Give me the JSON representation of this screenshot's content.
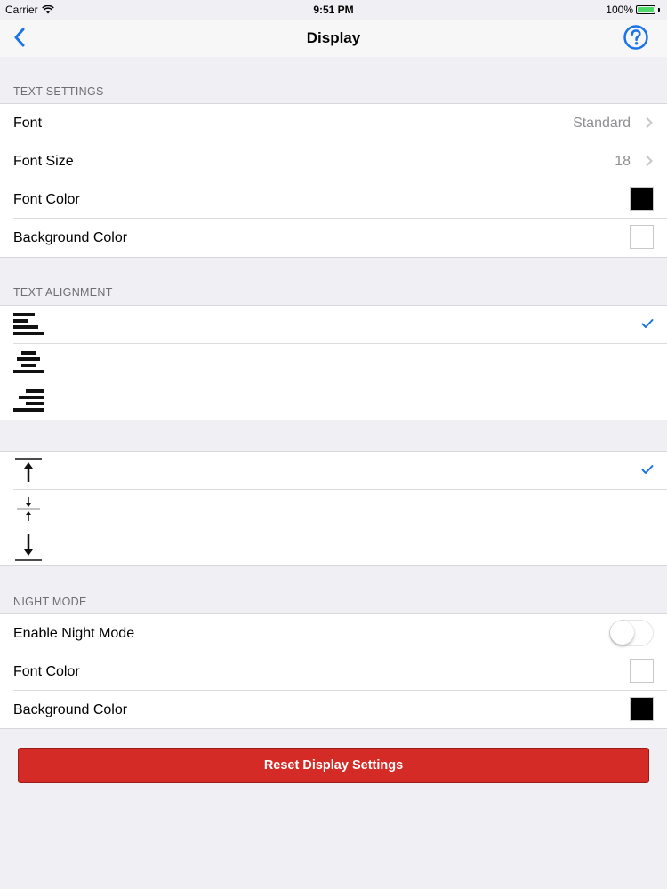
{
  "status_bar": {
    "carrier": "Carrier",
    "time": "9:51 PM",
    "battery": "100%",
    "battery_level": 1.0,
    "battery_color": "#4cd964"
  },
  "nav": {
    "title": "Display",
    "back_icon": "chevron-left-icon",
    "help_icon": "question-circle-icon",
    "accent_color": "#1a73e8"
  },
  "text_settings": {
    "header": "TEXT SETTINGS",
    "rows": [
      {
        "label": "Font",
        "value": "Standard"
      },
      {
        "label": "Font Size",
        "value": "18"
      },
      {
        "label": "Font Color",
        "swatch_color": "#000000"
      },
      {
        "label": "Background Color",
        "swatch_color": "#ffffff"
      }
    ]
  },
  "text_alignment": {
    "header": "TEXT ALIGNMENT",
    "options": [
      {
        "icon": "align-left-icon",
        "selected": true
      },
      {
        "icon": "align-center-icon",
        "selected": false
      },
      {
        "icon": "align-right-icon",
        "selected": false
      }
    ]
  },
  "vertical_alignment": {
    "options": [
      {
        "icon": "align-top-icon",
        "selected": true
      },
      {
        "icon": "align-middle-icon",
        "selected": false
      },
      {
        "icon": "align-bottom-icon",
        "selected": false
      }
    ]
  },
  "night_mode": {
    "header": "NIGHT MODE",
    "enable_label": "Enable Night Mode",
    "enabled": false,
    "rows": [
      {
        "label": "Font Color",
        "swatch_color": "#ffffff"
      },
      {
        "label": "Background Color",
        "swatch_color": "#000000"
      }
    ]
  },
  "reset_button": {
    "label": "Reset Display Settings",
    "color": "#d52b26"
  }
}
